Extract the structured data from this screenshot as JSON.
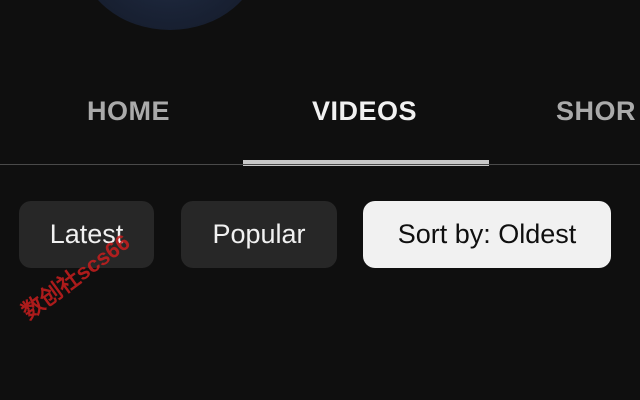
{
  "tabs": {
    "home": "HOME",
    "videos": "VIDEOS",
    "shorts": "SHOR",
    "active": "VIDEOS"
  },
  "filters": {
    "latest": "Latest",
    "popular": "Popular",
    "sort": "Sort by: Oldest",
    "selected": "Sort by: Oldest"
  },
  "watermark": "数创社scs66",
  "colors": {
    "background": "#0f0f0f",
    "chip": "#272727",
    "chip_selected": "#f1f1f1",
    "tab_inactive": "#aaaaaa",
    "tab_active": "#f1f1f1",
    "watermark": "#c81e1e"
  }
}
